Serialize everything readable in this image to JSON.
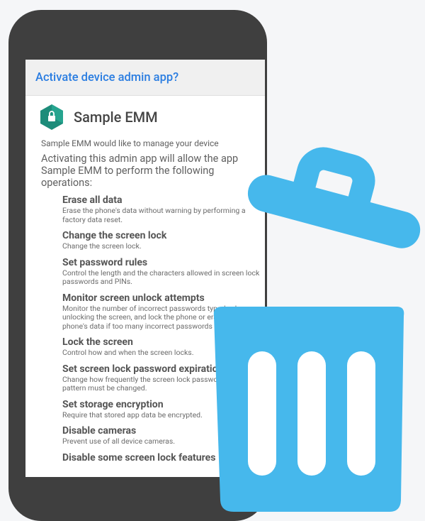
{
  "dialog": {
    "title": "Activate device admin app?",
    "app_name": "Sample EMM",
    "app_icon": "lock-hexagon-icon",
    "request_text": "Sample EMM would like to manage your device",
    "explanation": "Activating this admin app will allow the app Sample EMM to perform the following operations:",
    "policies": [
      {
        "title": "Erase all data",
        "description": "Erase the phone's data without warning by performing a factory data reset."
      },
      {
        "title": "Change the screen lock",
        "description": "Change the screen lock."
      },
      {
        "title": "Set password rules",
        "description": "Control the length and the characters allowed in screen lock passwords and PINs."
      },
      {
        "title": "Monitor screen unlock attempts",
        "description": "Monitor the number of incorrect passwords typed. when unlocking the screen, and lock the phone or erase all the phone's data if too many incorrect passwords are typed."
      },
      {
        "title": "Lock the screen",
        "description": "Control how and when the screen locks."
      },
      {
        "title": "Set screen lock password expiration",
        "description": "Change how frequently the screen lock password, PIN, or pattern must be changed."
      },
      {
        "title": "Set storage encryption",
        "description": "Require that stored app data be encrypted."
      },
      {
        "title": "Disable cameras",
        "description": "Prevent use of all device cameras."
      },
      {
        "title": "Disable some screen lock features",
        "description": ""
      }
    ]
  },
  "overlay": {
    "icon": "trash-icon",
    "color": "#46b8ec"
  },
  "colors": {
    "accent": "#2a7de1",
    "icon_green": "#1d8c7a",
    "phone": "#3f3f3f"
  }
}
